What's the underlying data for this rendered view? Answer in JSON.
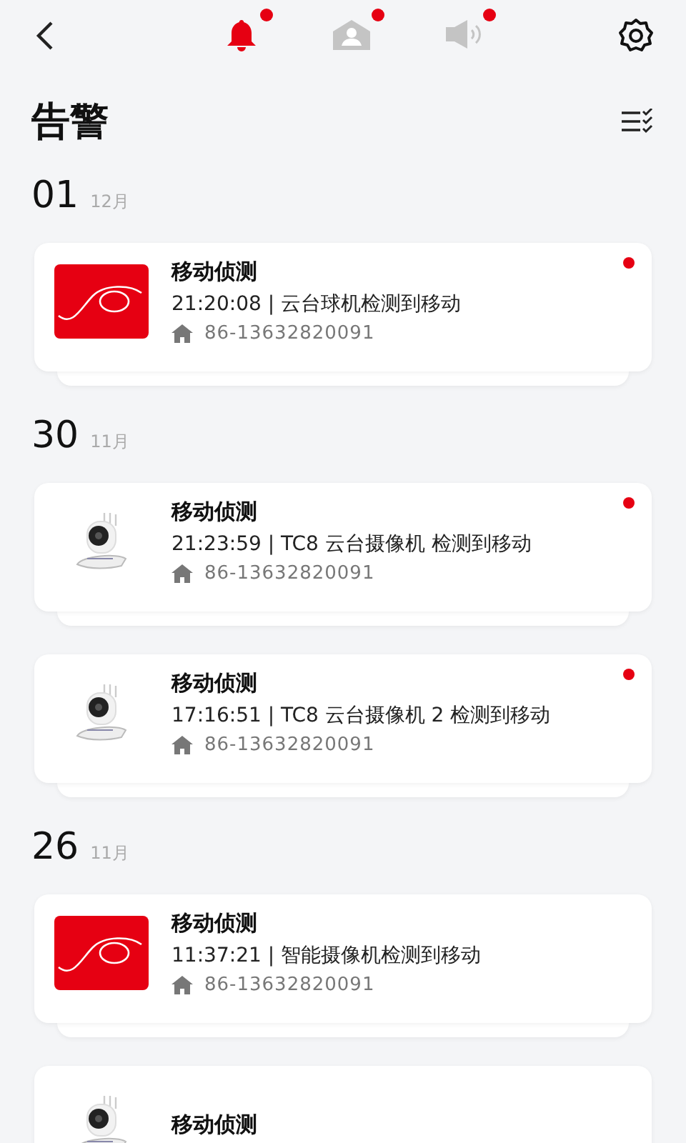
{
  "tabs": [
    {
      "kind": "bell",
      "selected": true,
      "unread": true
    },
    {
      "kind": "home",
      "selected": false,
      "unread": true
    },
    {
      "kind": "speaker",
      "selected": false,
      "unread": true
    }
  ],
  "title": "告警",
  "groups": [
    {
      "day": "01",
      "month": "12月",
      "events": [
        {
          "kind": "logo",
          "title": "移动侦测",
          "detail": "21:20:08 | 云台球机检测到移动",
          "device": "86-13632820091",
          "unread": true
        }
      ]
    },
    {
      "day": "30",
      "month": "11月",
      "events": [
        {
          "kind": "camera",
          "title": "移动侦测",
          "detail": "21:23:59 | TC8 云台摄像机 检测到移动",
          "device": "86-13632820091",
          "unread": true
        },
        {
          "kind": "camera",
          "title": "移动侦测",
          "detail": "17:16:51 | TC8 云台摄像机 2 检测到移动",
          "device": "86-13632820091",
          "unread": true
        }
      ]
    },
    {
      "day": "26",
      "month": "11月",
      "events": [
        {
          "kind": "logo",
          "title": "移动侦测",
          "detail": "11:37:21 | 智能摄像机检测到移动",
          "device": "86-13632820091",
          "unread": false
        },
        {
          "kind": "camera",
          "title": "移动侦测",
          "unread": false
        }
      ]
    }
  ]
}
